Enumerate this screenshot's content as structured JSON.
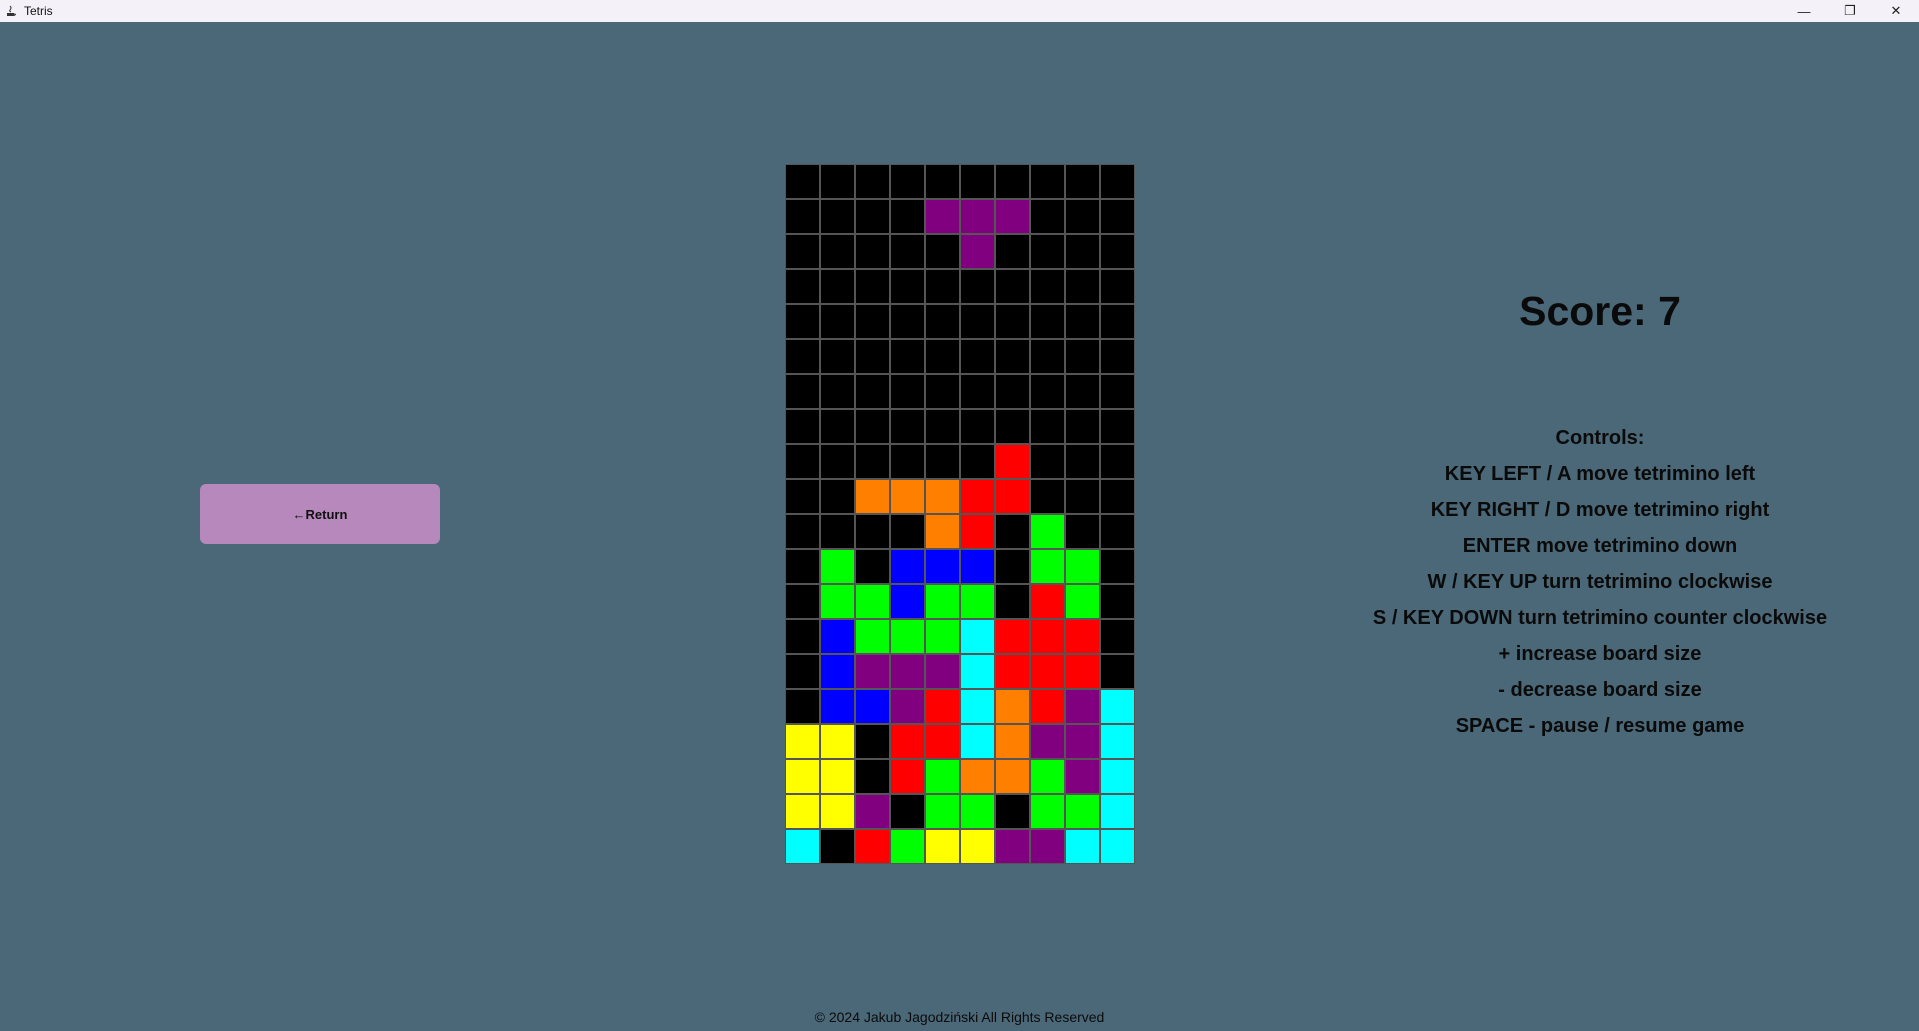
{
  "window": {
    "title": "Tetris",
    "minimize_glyph": "—",
    "maximize_glyph": "❐",
    "close_glyph": "✕"
  },
  "return_button": {
    "label": "←Return"
  },
  "score": {
    "text": "Score: 7"
  },
  "controls": {
    "title": "Controls:",
    "lines": [
      "KEY LEFT / A move tetrimino left",
      "KEY RIGHT / D move tetrimino right",
      "ENTER move tetrimino down",
      "W / KEY UP turn tetrimino clockwise",
      "S / KEY DOWN turn tetrimino counter clockwise",
      "+ increase board size",
      "- decrease board size",
      "SPACE - pause / resume game"
    ]
  },
  "footer": {
    "text": "© 2024 Jakub Jagodziński All Rights Reserved"
  },
  "board": {
    "columns": 10,
    "rows": 20,
    "colors": {
      ".": "#000000",
      "P": "#800080",
      "R": "#ff0000",
      "O": "#ff8000",
      "G": "#00ff00",
      "B": "#0000ff",
      "C": "#00ffff",
      "Y": "#ffff00"
    },
    "grid": [
      "..........",
      "....PPP...",
      ".....P....",
      "..........",
      "..........",
      "..........",
      "..........",
      "..........",
      "......R...",
      "..OOORR...",
      "....OR.G..",
      ".G.BBB.GG.",
      ".GGBGG.RG.",
      ".BGGGCRRR.",
      ".BPPPCRRR.",
      ".BBPRCORPC",
      "YY.RRCOPPC",
      "YY.RGOOGPC",
      "YYP.GG.GGC",
      "C.RGYYPPCC"
    ]
  }
}
